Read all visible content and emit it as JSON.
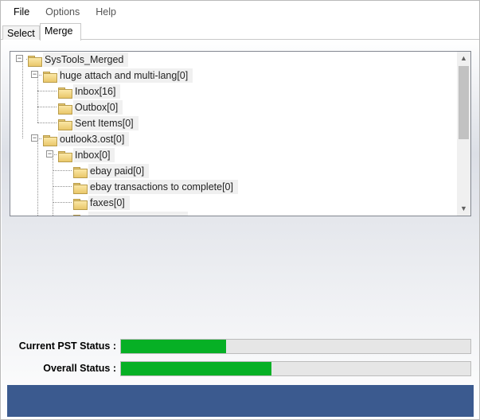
{
  "menu": [
    "File",
    "Options",
    "Help"
  ],
  "tabs": {
    "select": "Select",
    "merge": "Merge"
  },
  "tree": {
    "root": "SysTools_Merged",
    "pst1": {
      "label": "huge attach and multi-lang[0]",
      "children": [
        "Inbox[16]",
        "Outbox[0]",
        "Sent Items[0]"
      ]
    },
    "pst2": {
      "label": "outlook3.ost[0]",
      "inbox": "Inbox[0]",
      "inbox_children": [
        "ebay paid[0]",
        "ebay transactions to complete[0]",
        "faxes[0]"
      ]
    }
  },
  "status": {
    "current_label": "Current PST Status :",
    "current_progress": 0.3,
    "overall_label": "Overall Status :",
    "overall_progress": 0.43,
    "progress_color": "#06b025"
  },
  "colors": {
    "footer": "#3b5a8f"
  }
}
